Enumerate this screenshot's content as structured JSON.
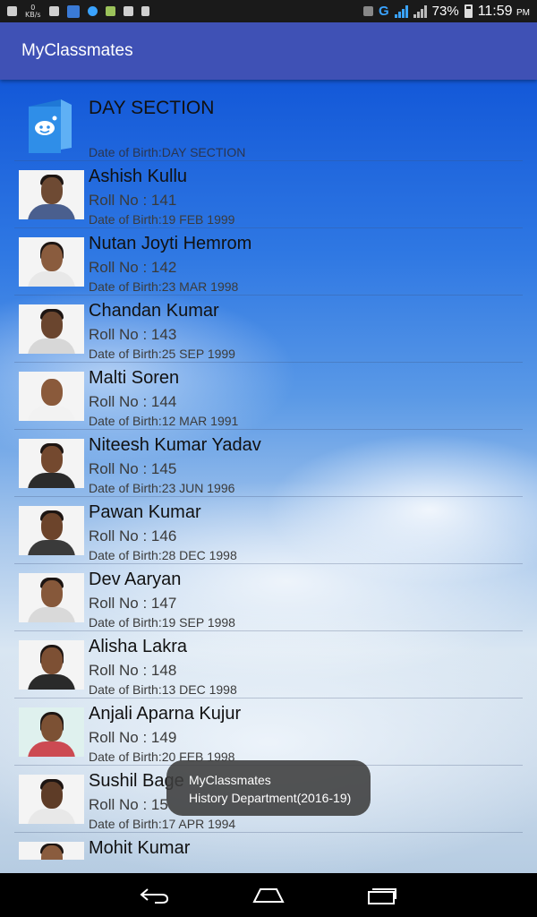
{
  "status_bar": {
    "kbs_value": "0",
    "kbs_unit": "KB/s",
    "network_type": "G",
    "battery": "73%",
    "time": "11:59",
    "ampm": "PM"
  },
  "app_bar": {
    "title": "MyClassmates"
  },
  "header": {
    "title": "DAY SECTION",
    "dob": "Date of Birth:DAY SECTION"
  },
  "students": [
    {
      "name": "Ashish Kullu",
      "roll": "Roll No : 141",
      "dob": "Date of Birth:19 FEB 1999"
    },
    {
      "name": "Nutan Joyti Hemrom",
      "roll": "Roll No : 142",
      "dob": "Date of Birth:23 MAR 1998"
    },
    {
      "name": "Chandan Kumar",
      "roll": "Roll No : 143",
      "dob": "Date of Birth:25 SEP 1999"
    },
    {
      "name": "Malti Soren",
      "roll": "Roll No : 144",
      "dob": "Date of Birth:12 MAR 1991"
    },
    {
      "name": "Niteesh Kumar Yadav",
      "roll": "Roll No : 145",
      "dob": "Date of Birth:23 JUN 1996"
    },
    {
      "name": "Pawan Kumar",
      "roll": "Roll No : 146",
      "dob": "Date of Birth:28 DEC 1998"
    },
    {
      "name": "Dev Aaryan",
      "roll": "Roll No : 147",
      "dob": "Date of Birth:19 SEP 1998"
    },
    {
      "name": "Alisha Lakra",
      "roll": "Roll No : 148",
      "dob": "Date of Birth:13 DEC 1998"
    },
    {
      "name": "Anjali Aparna Kujur",
      "roll": "Roll No : 149",
      "dob": "Date of Birth:20 FEB 1998"
    },
    {
      "name": "Sushil Bage",
      "roll": "Roll No : 15",
      "dob": "Date of Birth:17 APR 1994"
    },
    {
      "name": "Mohit Kumar",
      "roll": "",
      "dob": ""
    }
  ],
  "toast": {
    "line1": "MyClassmates",
    "line2": "History Department(2016-19)"
  },
  "colors": {
    "app_bar": "#3f51b5",
    "header_icon": "#2f8ee8"
  },
  "icons": {
    "back": "back-icon",
    "home": "home-icon",
    "recents": "recents-icon"
  }
}
